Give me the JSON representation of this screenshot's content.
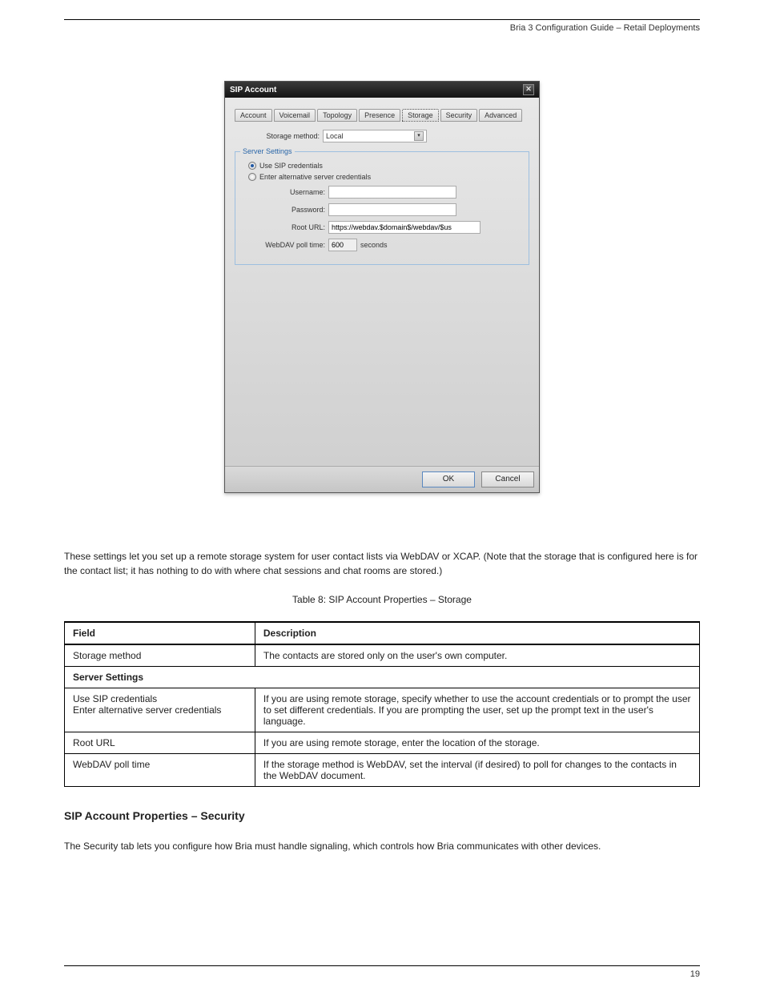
{
  "header": {
    "right": "Bria 3 Configuration Guide  –  Retail Deployments"
  },
  "dialog": {
    "title": "SIP Account",
    "tabs": [
      "Account",
      "Voicemail",
      "Topology",
      "Presence",
      "Storage",
      "Security",
      "Advanced"
    ],
    "active_tab": "Storage",
    "storage_method_label": "Storage method:",
    "storage_method_value": "Local",
    "server_legend": "Server Settings",
    "radio_use_sip": "Use SIP credentials",
    "radio_alt": "Enter alternative server credentials",
    "username_label": "Username:",
    "password_label": "Password:",
    "root_url_label": "Root URL:",
    "root_url_value": "https://webdav.$domain$/webdav/$us",
    "poll_label": "WebDAV poll time:",
    "poll_value": "600",
    "poll_suffix": "seconds",
    "ok": "OK",
    "cancel": "Cancel"
  },
  "text": {
    "p1": "These settings let you set up a remote storage system for user contact lists via WebDAV or XCAP. (Note that the storage that is configured here is for the contact list; it has nothing to do with where chat sessions and chat rooms are stored.)",
    "table_caption": "Table 8: SIP Account Properties – Storage",
    "p2": "The Security tab lets you configure how Bria must handle signaling, which controls how Bria communicates with other devices."
  },
  "table": {
    "head": [
      "Field",
      "Description"
    ],
    "rows": [
      [
        "Storage method",
        "The contacts are stored only on the user's own computer."
      ],
      [
        "Server Settings",
        ""
      ],
      [
        "Use SIP credentials\nEnter alternative server credentials",
        "If you are using remote storage, specify whether to use the account credentials or to prompt the user to set different credentials. If you are prompting the user, set up the prompt text in the user's language."
      ],
      [
        "Root URL",
        "If you are using remote storage, enter the location of the storage."
      ],
      [
        "WebDAV poll time",
        "If the storage method is WebDAV, set the interval (if desired) to poll for changes to the contacts in the WebDAV document."
      ]
    ]
  },
  "section": {
    "title": "SIP Account Properties – Security"
  },
  "footer": {
    "left": "",
    "right": "19"
  }
}
